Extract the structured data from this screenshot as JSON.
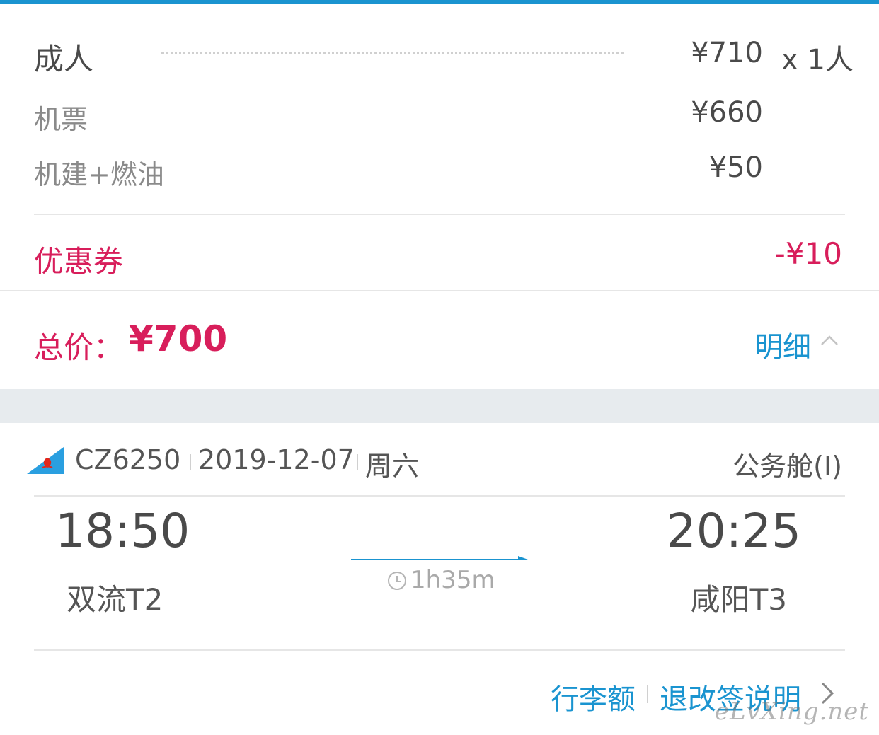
{
  "colors": {
    "accent_blue": "#1a94d0",
    "discount_pink": "#d81e5b",
    "text_dark": "#4a4a4a",
    "text_gray": "#8a8a8a"
  },
  "price": {
    "adult": {
      "label": "成人",
      "amount": "¥710",
      "count": "x 1人"
    },
    "ticket": {
      "label": "机票",
      "amount": "¥660"
    },
    "tax": {
      "label": "机建+燃油",
      "amount": "¥50"
    },
    "coupon": {
      "label": "优惠券",
      "amount": "-¥10"
    },
    "total": {
      "label": "总价：",
      "amount": "¥700"
    },
    "details_link": "明细"
  },
  "flight": {
    "airline_icon": "china-southern-airlines-logo",
    "number": "CZ6250",
    "date": "2019-12-07",
    "weekday": "周六",
    "cabin": "公务舱(I)",
    "departure": {
      "time": "18:50",
      "airport": "双流T2"
    },
    "arrival": {
      "time": "20:25",
      "airport": "咸阳T3"
    },
    "duration": "1h35m"
  },
  "footer": {
    "baggage_link": "行李额",
    "refund_link": "退改签说明"
  },
  "watermark": "eLvXing.net"
}
